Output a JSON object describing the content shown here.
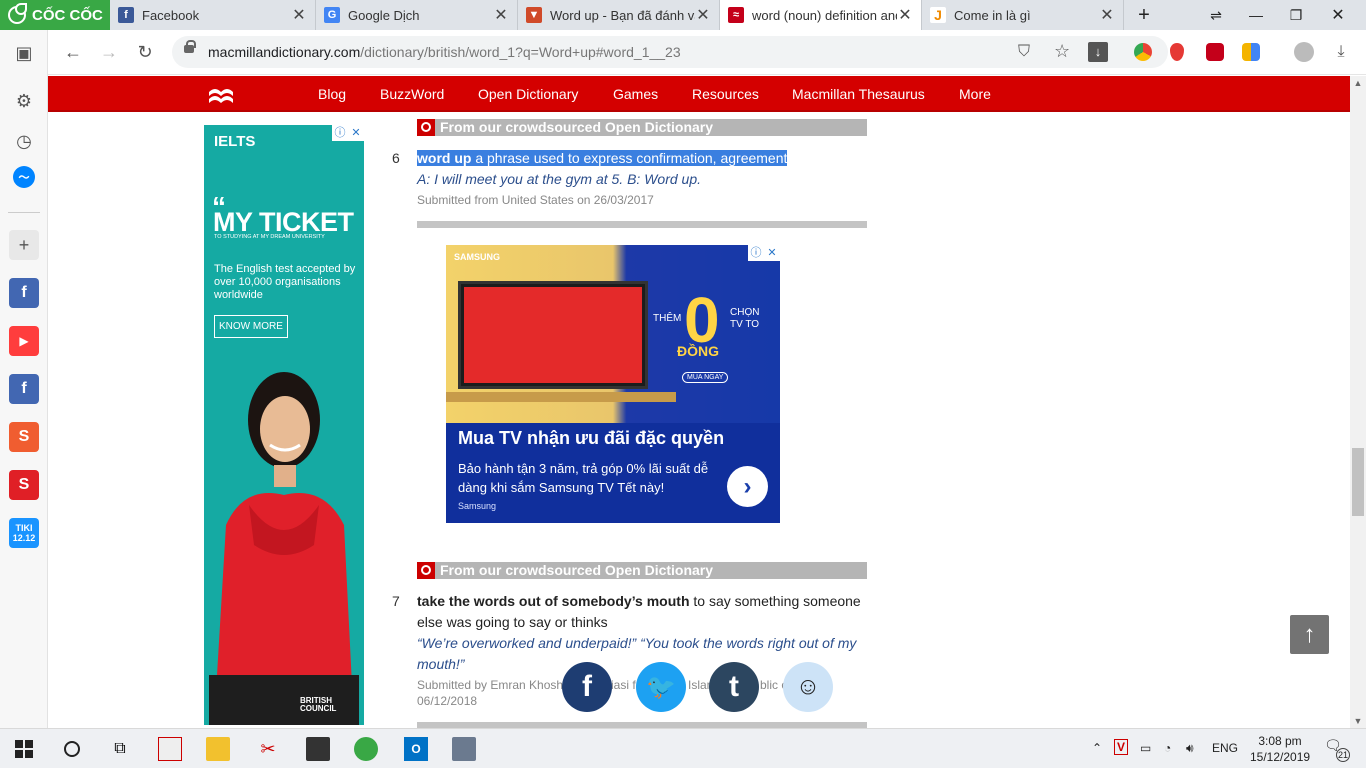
{
  "browser": {
    "brand": "CỐC CỐC",
    "tabs": [
      {
        "title": "Facebook",
        "icon": "facebook-icon",
        "color": "#3b5998"
      },
      {
        "title": "Google Dịch",
        "icon": "google-translate-icon",
        "color": "#4285f4"
      },
      {
        "title": "Word up - Bạn đã đánh văn",
        "icon": "oxford-icon",
        "color": "#d04a29"
      },
      {
        "title": "word (noun) definition and",
        "icon": "macmillan-icon",
        "color": "#c4001a"
      },
      {
        "title": "Come in là gì",
        "icon": "j-icon",
        "color": "#f08a00"
      }
    ],
    "url_domain": "macmillandictionary.com",
    "url_path": "/dictionary/british/word_1?q=Word+up#word_1__23"
  },
  "site_nav": {
    "items": [
      "Blog",
      "BuzzWord",
      "Open Dictionary",
      "Games",
      "Resources",
      "Macmillan Thesaurus",
      "More"
    ]
  },
  "ielts_ad": {
    "logo": "IELTS",
    "headline": "MY TICKET",
    "tagline": "TO STUDYING AT MY DREAM UNIVERSITY",
    "text": "The English test accepted by over 10,000 organisations worldwide",
    "button": "KNOW MORE",
    "footer": "BRITISH COUNCIL"
  },
  "entries": [
    {
      "header": "From our crowdsourced Open Dictionary",
      "number": "6",
      "term": "word up",
      "definition": " a phrase used to express confirmation, agreement",
      "example": "A: I will meet you at the gym at 5. B: Word up.",
      "submitted": "Submitted from United States on 26/03/2017"
    },
    {
      "header": "From our crowdsourced Open Dictionary",
      "number": "7",
      "term": "take the words out of somebody’s mouth",
      "definition_line1": " to say something someone",
      "definition_line2": "else was going to say or thinks",
      "example_line1": "“We’re overworked and underpaid!” “You took the words right out of my",
      "example_line2": "mouth!”",
      "submitted_line1": "Submitted by Emran Khosh",
      "submitted_line1b": "iasi f",
      "submitted_line1c": "Islan",
      "submitted_line1d": "blic o",
      "submitted_line2": "06/12/2018"
    }
  ],
  "samsung_ad": {
    "brand": "SAMSUNG",
    "them": "THÊM",
    "zero": "0",
    "dong": "ĐỒNG",
    "chon": "CHỌN TV TO",
    "mua": "MUA NGAY",
    "headline": "Mua TV nhận ưu đãi đặc quyền",
    "body": "Bảo hành tận 3 năm, trả góp 0% lãi suất dễ dàng khi sắm Samsung TV Tết này!",
    "source": "Samsung"
  },
  "taskbar": {
    "lang": "ENG",
    "time": "3:08 pm",
    "date": "15/12/2019",
    "notif_count": "21"
  }
}
